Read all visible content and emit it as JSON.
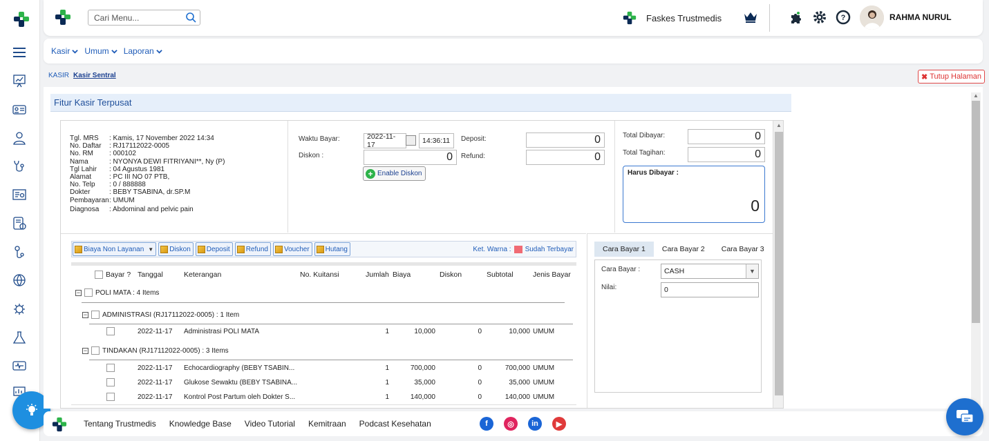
{
  "header": {
    "search_placeholder": "Cari Menu...",
    "facility": "Faskes Trustmedis",
    "user": "RAHMA NURUL"
  },
  "menubar": {
    "items": [
      {
        "label": "Kasir"
      },
      {
        "label": "Umum"
      },
      {
        "label": "Laporan"
      }
    ]
  },
  "breadcrumb": {
    "root": "KASIR",
    "current": "Kasir Sentral"
  },
  "close_page": "Tutup Halaman",
  "panel_title": "Fitur Kasir Terpusat",
  "patient": [
    {
      "k": "Tgl. MRS",
      "v": ": Kamis, 17 November 2022 14:34"
    },
    {
      "k": "No. Daftar",
      "v": ": RJ17112022-0005"
    },
    {
      "k": "No. RM",
      "v": ": 000102"
    },
    {
      "k": "Nama",
      "v": ": NYONYA DEWI FITRIYANI**, Ny (P)"
    },
    {
      "k": "Tgl Lahir",
      "v": ": 04 Agustus 1981"
    },
    {
      "k": "Alamat",
      "v": ": PC III NO 07 PTB,"
    },
    {
      "k": "No. Telp",
      "v": ": 0 / 888888"
    },
    {
      "k": "Dokter",
      "v": ": BEBY TSABINA, dr.SP.M"
    },
    {
      "k": "Pembayaran",
      "v": ": UMUM"
    },
    {
      "k": "Diagnosa",
      "v": ": Abdominal and pelvic pain"
    }
  ],
  "payment": {
    "waktu_label": "Waktu Bayar:",
    "date": "2022-11-17",
    "time": "14:36:11",
    "diskon_label": "Diskon :",
    "diskon_value": "0",
    "deposit_label": "Deposit:",
    "deposit_value": "0",
    "refund_label": "Refund:",
    "refund_value": "0",
    "enable_diskon": "Enable Diskon"
  },
  "totals": {
    "dibayar_label": "Total Dibayar:",
    "dibayar_value": "0",
    "tagihan_label": "Total Tagihan:",
    "tagihan_value": "0",
    "harus_label": "Harus Dibayar :",
    "harus_value": "0"
  },
  "toolbar": {
    "biaya_non": "Biaya Non Layanan",
    "diskon": "Diskon",
    "deposit": "Deposit",
    "refund": "Refund",
    "voucher": "Voucher",
    "hutang": "Hutang",
    "ket_warna": "Ket. Warna :",
    "sudah_terbayar": "Sudah Terbayar",
    "sudah_color": "#f06b74"
  },
  "grid": {
    "headers": {
      "bayar": "Bayar ?",
      "tanggal": "Tanggal",
      "keterangan": "Keterangan",
      "kuitansi": "No. Kuitansi",
      "jumlah": "Jumlah",
      "biaya": "Biaya",
      "diskon": "Diskon",
      "subtotal": "Subtotal",
      "jenis": "Jenis Bayar"
    },
    "group_poli": "POLI MATA : 4 Items",
    "group_admin": "ADMINISTRASI (RJ17112022-0005) : 1 Item",
    "group_tindakan": "TINDAKAN (RJ17112022-0005) : 3 Items",
    "admin_rows": [
      {
        "tanggal": "2022-11-17",
        "ket": "Administrasi POLI MATA",
        "jumlah": "1",
        "biaya": "10,000",
        "diskon": "0",
        "subtotal": "10,000",
        "jenis": "UMUM"
      }
    ],
    "tindakan_rows": [
      {
        "tanggal": "2022-11-17",
        "ket": "Echocardiography (BEBY TSABIN...",
        "jumlah": "1",
        "biaya": "700,000",
        "diskon": "0",
        "subtotal": "700,000",
        "jenis": "UMUM"
      },
      {
        "tanggal": "2022-11-17",
        "ket": "Glukose Sewaktu (BEBY TSABINA...",
        "jumlah": "1",
        "biaya": "35,000",
        "diskon": "0",
        "subtotal": "35,000",
        "jenis": "UMUM"
      },
      {
        "tanggal": "2022-11-17",
        "ket": "Kontrol Post Partum oleh Dokter S...",
        "jumlah": "1",
        "biaya": "140,000",
        "diskon": "0",
        "subtotal": "140,000",
        "jenis": "UMUM"
      }
    ]
  },
  "cara_bayar": {
    "tabs": [
      {
        "label": "Cara Bayar 1"
      },
      {
        "label": "Cara Bayar 2"
      },
      {
        "label": "Cara Bayar 3"
      }
    ],
    "cara_label": "Cara Bayar :",
    "cara_value": "CASH",
    "nilai_label": "Nilai:",
    "nilai_value": "0"
  },
  "footer": {
    "links": [
      {
        "label": "Tentang Trustmedis"
      },
      {
        "label": "Knowledge Base"
      },
      {
        "label": "Video Tutorial"
      },
      {
        "label": "Kemitraan"
      },
      {
        "label": "Podcast Kesehatan"
      }
    ]
  },
  "colors": {
    "accent": "#1f5cb8",
    "brand_green": "#2db34a",
    "brand_navy": "#0b2a55"
  }
}
